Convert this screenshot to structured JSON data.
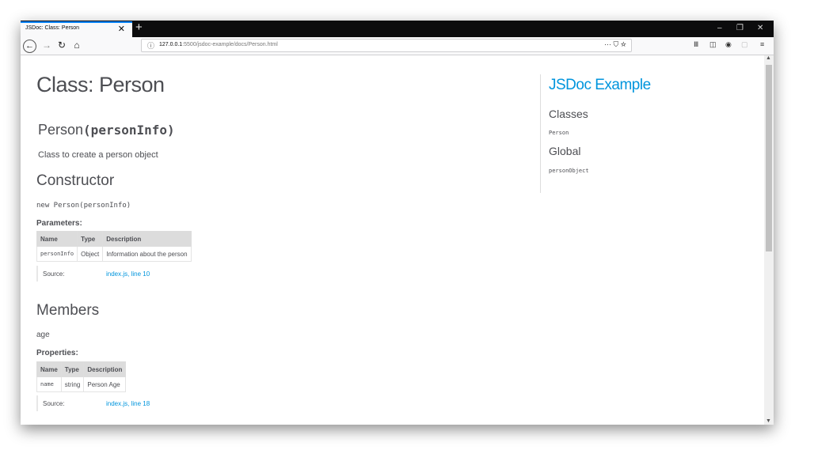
{
  "browser": {
    "tab_title": "JSDoc: Class: Person",
    "tab_close": "✕",
    "new_tab": "+",
    "window_controls": {
      "minimize": "–",
      "restore": "❐",
      "close": "✕"
    },
    "url_info_icon": "ⓘ",
    "url_host": "127.0.0.1",
    "url_rest": ":5500/jsdoc-example/docs/Person.html",
    "url_actions": "··· ⛉ ☆"
  },
  "page": {
    "title": "Class: Person",
    "signature_name": "Person",
    "signature_params": "(personInfo)",
    "description": "Class to create a person object",
    "constructor_heading": "Constructor",
    "constructor_code": "new Person(personInfo)",
    "parameters_heading": "Parameters:",
    "param_headers": [
      "Name",
      "Type",
      "Description"
    ],
    "param_rows": [
      [
        "personInfo",
        "Object",
        "Information about the person"
      ]
    ],
    "source1_label": "Source:",
    "source1_link": "index.js, line 10",
    "members_heading": "Members",
    "member_name": "age",
    "properties_heading": "Properties:",
    "prop_headers": [
      "Name",
      "Type",
      "Description"
    ],
    "prop_rows": [
      [
        "name",
        "string",
        "Person Age"
      ]
    ],
    "source2_label": "Source:",
    "source2_link": "index.js, line 18"
  },
  "sidebar": {
    "brand": "JSDoc Example",
    "classes_heading": "Classes",
    "classes": [
      "Person"
    ],
    "global_heading": "Global",
    "globals": [
      "personObject"
    ]
  },
  "colors": {
    "accent": "#0095dd",
    "text": "#4d4e53",
    "titlebar": "#0c0c0d",
    "tab_highlight": "#0a84ff"
  },
  "icons": [
    "back-icon",
    "forward-icon",
    "reload-icon",
    "home-icon",
    "info-icon",
    "library-icon",
    "sidebar-icon",
    "account-icon",
    "extension-icon",
    "menu-icon"
  ]
}
